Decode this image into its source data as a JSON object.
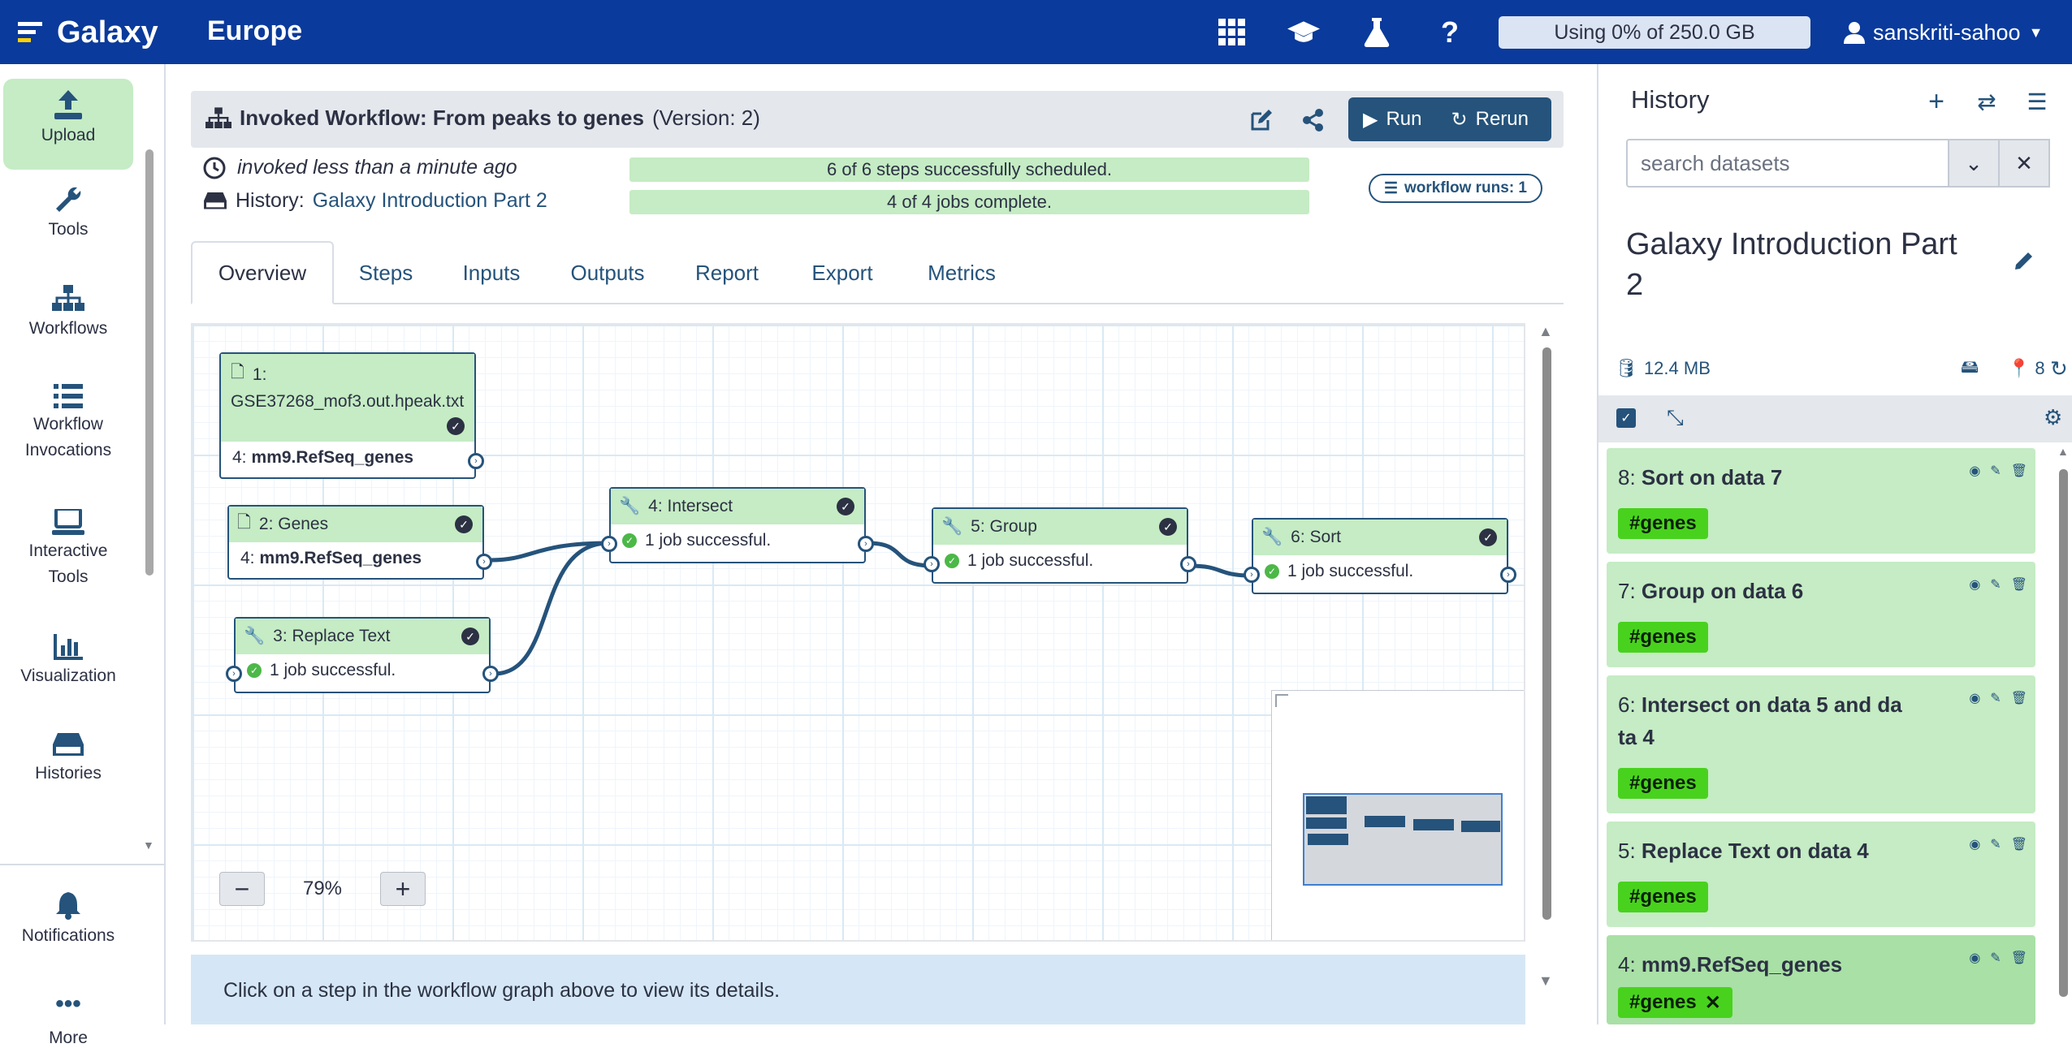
{
  "masthead": {
    "brand": "Galaxy",
    "subtitle": "Europe",
    "quota": "Using 0% of 250.0 GB",
    "user": "sanskriti-sahoo",
    "bg_color": "#0a3a9b"
  },
  "activity": {
    "upload": "Upload",
    "tools": "Tools",
    "workflows": "Workflows",
    "invocations_1": "Workflow",
    "invocations_2": "Invocations",
    "interactive_1": "Interactive",
    "interactive_2": "Tools",
    "visualization": "Visualization",
    "histories": "Histories",
    "notifications": "Notifications",
    "more": "More"
  },
  "workflow": {
    "title_prefix": "Invoked Workflow: From peaks to genes",
    "version": "(Version: 2)",
    "run": "Run",
    "rerun": "Rerun",
    "invoked": "invoked less than a minute ago",
    "history_label": "History:",
    "history_name": "Galaxy Introduction Part 2",
    "steps_progress": "6 of 6 steps successfully scheduled.",
    "jobs_progress": "4 of 4 jobs complete.",
    "runs_badge": "workflow runs: 1",
    "success_color": "#c5ecc4"
  },
  "tabs": [
    "Overview",
    "Steps",
    "Inputs",
    "Outputs",
    "Report",
    "Export",
    "Metrics"
  ],
  "graph": {
    "n1_title": "1:",
    "n1_file": "GSE37268_mof3.out.hpeak.txt",
    "n1_out_num": "4:",
    "n1_out_name": "mm9.RefSeq_genes",
    "n2_title": "2: Genes",
    "n2_out_num": "4:",
    "n2_out_name": "mm9.RefSeq_genes",
    "n3_title": "3: Replace Text",
    "n4_title": "4: Intersect",
    "n5_title": "5: Group",
    "n6_title": "6: Sort",
    "job_ok": "1 job successful.",
    "zoom": "79%"
  },
  "info": "Click on a step in the workflow graph above to view its details.",
  "history": {
    "title": "History",
    "search_placeholder": "search datasets",
    "name_1": "Galaxy Introduction Part",
    "name_2": "2",
    "size": "12.4 MB",
    "count": "8",
    "items": [
      {
        "num": "8:",
        "name": "Sort on data 7",
        "tag": "#genes"
      },
      {
        "num": "7:",
        "name": "Group on data 6",
        "tag": "#genes"
      },
      {
        "num": "6:",
        "name": "Intersect on data 5 and da",
        "name2": "ta 4",
        "tag": "#genes"
      },
      {
        "num": "5:",
        "name": "Replace Text on data 4",
        "tag": "#genes"
      },
      {
        "num": "4:",
        "name": "mm9.RefSeq_genes",
        "tag": "#genes"
      }
    ]
  }
}
